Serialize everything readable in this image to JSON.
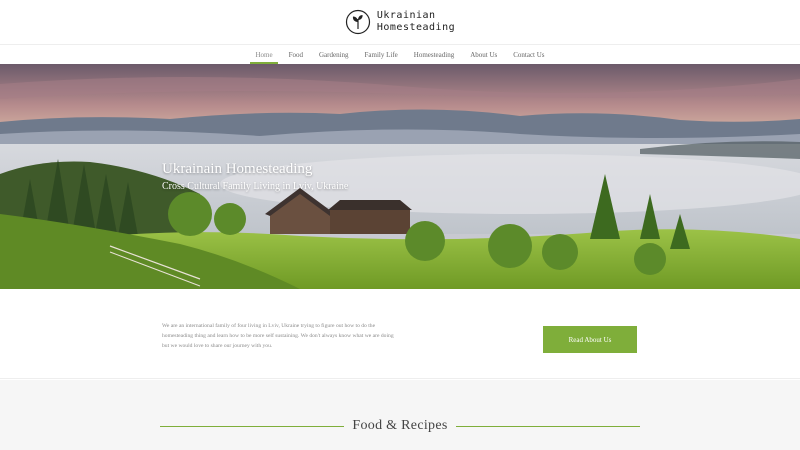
{
  "brand": {
    "line1": "Ukrainian",
    "line2": "Homesteading"
  },
  "nav": {
    "items": [
      {
        "label": "Home"
      },
      {
        "label": "Food"
      },
      {
        "label": "Gardening"
      },
      {
        "label": "Family Life"
      },
      {
        "label": "Homesteading"
      },
      {
        "label": "About Us"
      },
      {
        "label": "Contact Us"
      }
    ]
  },
  "hero": {
    "title": "Ukrainain Homesteading",
    "subtitle": "Cross Cultural Family Living in Lviv, Ukraine"
  },
  "intro": {
    "text": "We are an international family of four living in Lviv, Ukraine trying to figure out how to do the homesteading thing and learn how to be more self sustaining. We don't always know what we are doing but we would love to share our journey with you.",
    "button_label": "Read About Us"
  },
  "food_section": {
    "title": "Food & Recipes"
  },
  "colors": {
    "accent": "#7fae3a"
  }
}
